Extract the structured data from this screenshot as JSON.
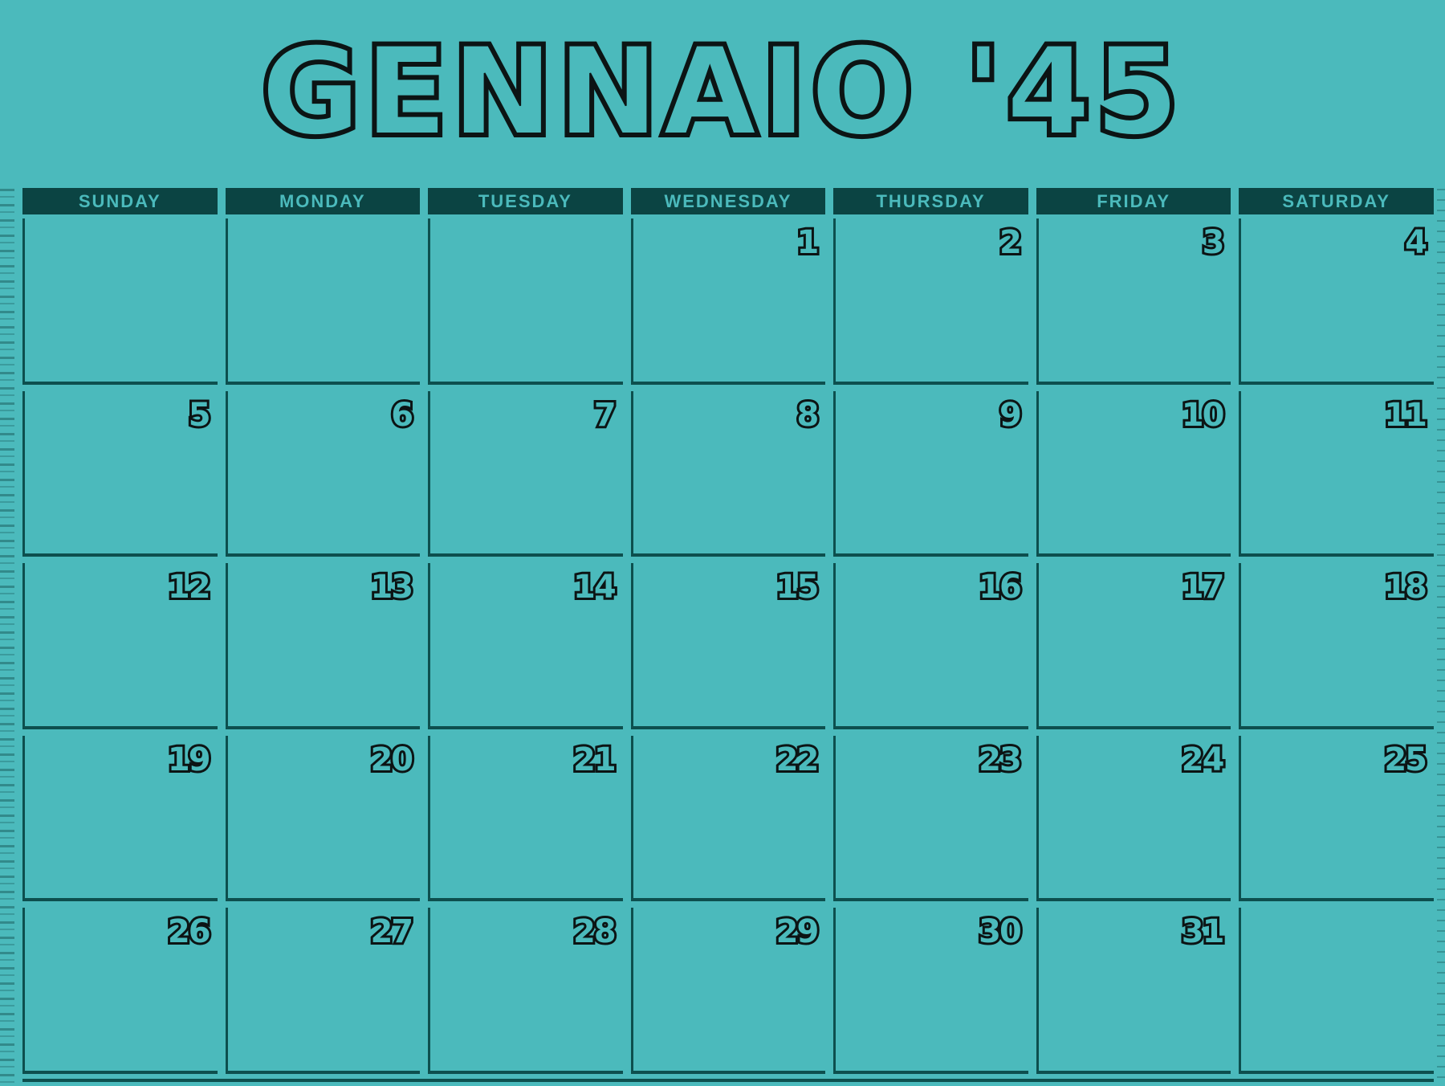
{
  "calendar": {
    "title": "GENNAIO '45",
    "weekdays": [
      "SUNDAY",
      "MONDAY",
      "TUESDAY",
      "WEDNESDAY",
      "THURSDAY",
      "FRIDAY",
      "SATURDAY"
    ],
    "weeks": [
      [
        "",
        "",
        "",
        "1",
        "2",
        "3",
        "4"
      ],
      [
        "5",
        "6",
        "7",
        "8",
        "9",
        "10",
        "11"
      ],
      [
        "12",
        "13",
        "14",
        "15",
        "16",
        "17",
        "18"
      ],
      [
        "19",
        "20",
        "21",
        "22",
        "23",
        "24",
        "25"
      ],
      [
        "26",
        "27",
        "28",
        "29",
        "30",
        "31",
        ""
      ]
    ]
  },
  "colors": {
    "background": "#4bbabc",
    "header_bar": "#0b4443",
    "grid_lines": "#0d4f4e",
    "ink": "#0c1414"
  }
}
